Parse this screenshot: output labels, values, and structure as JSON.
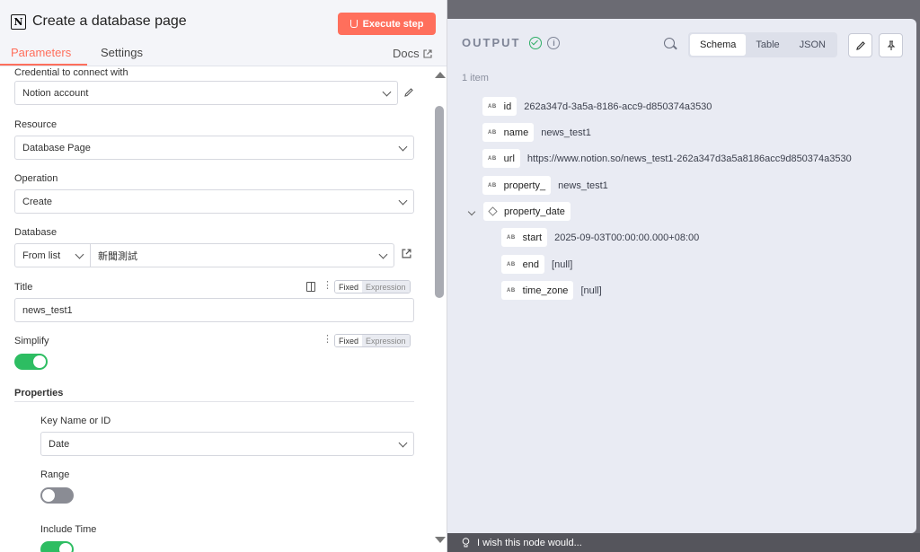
{
  "header": {
    "title": "Create a database page",
    "execute_label": "Execute step",
    "tabs": [
      "Parameters",
      "Settings"
    ],
    "docs_label": "Docs"
  },
  "form": {
    "credential": {
      "label": "Credential to connect with",
      "value": "Notion account"
    },
    "resource": {
      "label": "Resource",
      "value": "Database Page"
    },
    "operation": {
      "label": "Operation",
      "value": "Create"
    },
    "database": {
      "label": "Database",
      "mode": "From list",
      "value": "新聞測試"
    },
    "title": {
      "label": "Title",
      "value": "news_test1",
      "fixed": "Fixed",
      "expression": "Expression"
    },
    "simplify": {
      "label": "Simplify",
      "fixed": "Fixed",
      "expression": "Expression",
      "on": true
    },
    "properties": {
      "label": "Properties",
      "key_label": "Key Name or ID",
      "key_value": "Date",
      "range_label": "Range",
      "range_on": false,
      "include_time_label": "Include Time",
      "include_time_on": true
    }
  },
  "output": {
    "title": "OUTPUT",
    "views": [
      "Schema",
      "Table",
      "JSON"
    ],
    "active_view": "Schema",
    "items_count": "1 item",
    "type_tag": "AB",
    "fields": [
      {
        "key": "id",
        "value": "262a347d-3a5a-8186-acc9-d850374a3530"
      },
      {
        "key": "name",
        "value": "news_test1"
      },
      {
        "key": "url",
        "value": "https://www.notion.so/news_test1-262a347d3a5a8186acc9d850374a3530"
      },
      {
        "key": "property_",
        "value": "news_test1"
      },
      {
        "key": "property_date",
        "value": ""
      }
    ],
    "date_fields": [
      {
        "key": "start",
        "value": "2025-09-03T00:00:00.000+08:00"
      },
      {
        "key": "end",
        "value": "[null]"
      },
      {
        "key": "time_zone",
        "value": "[null]"
      }
    ]
  },
  "footer": {
    "text": "I wish this node would..."
  },
  "colors": {
    "accent": "#ff6f5c",
    "success": "#2dbd62"
  }
}
